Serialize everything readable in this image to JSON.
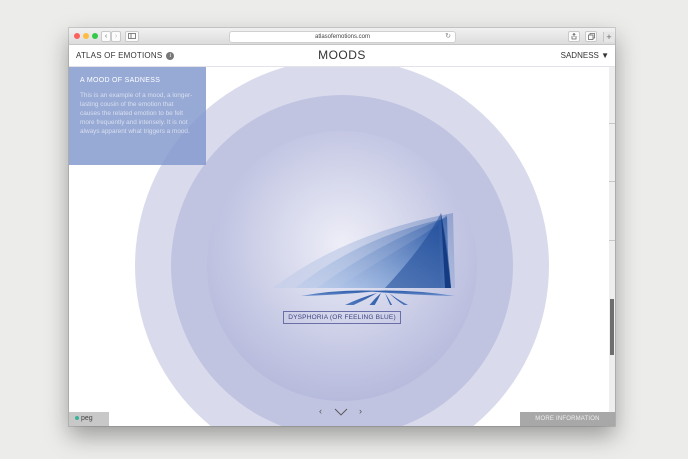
{
  "browser": {
    "url": "atlasofemotions.com",
    "new_tab_label": "+"
  },
  "header": {
    "brand": "ATLAS OF EMOTIONS",
    "info_icon_label": "i",
    "title": "MOODS",
    "emotion_select": "SADNESS ▼"
  },
  "mood_panel": {
    "heading": "A MOOD OF SADNESS",
    "description": "This is an example of a mood, a longer-lasting cousin of the emotion that causes the related emotion to be felt more frequently and intensely. It is not always apparent what triggers a mood."
  },
  "visualization": {
    "mood_label": "DYSPHORIA (OR FEELING BLUE)",
    "colors": {
      "outer_ring": "#d9dbec",
      "middle_ring": "#c1c4e1",
      "inner_ring": "#a7abd4",
      "glyph_blue": "#2f5fb0"
    }
  },
  "navigation": {
    "prev": "‹",
    "next": "›",
    "down_icon": "chevron-down-icon"
  },
  "footer": {
    "logo": "peg",
    "more_info": "MORE INFORMATION"
  }
}
